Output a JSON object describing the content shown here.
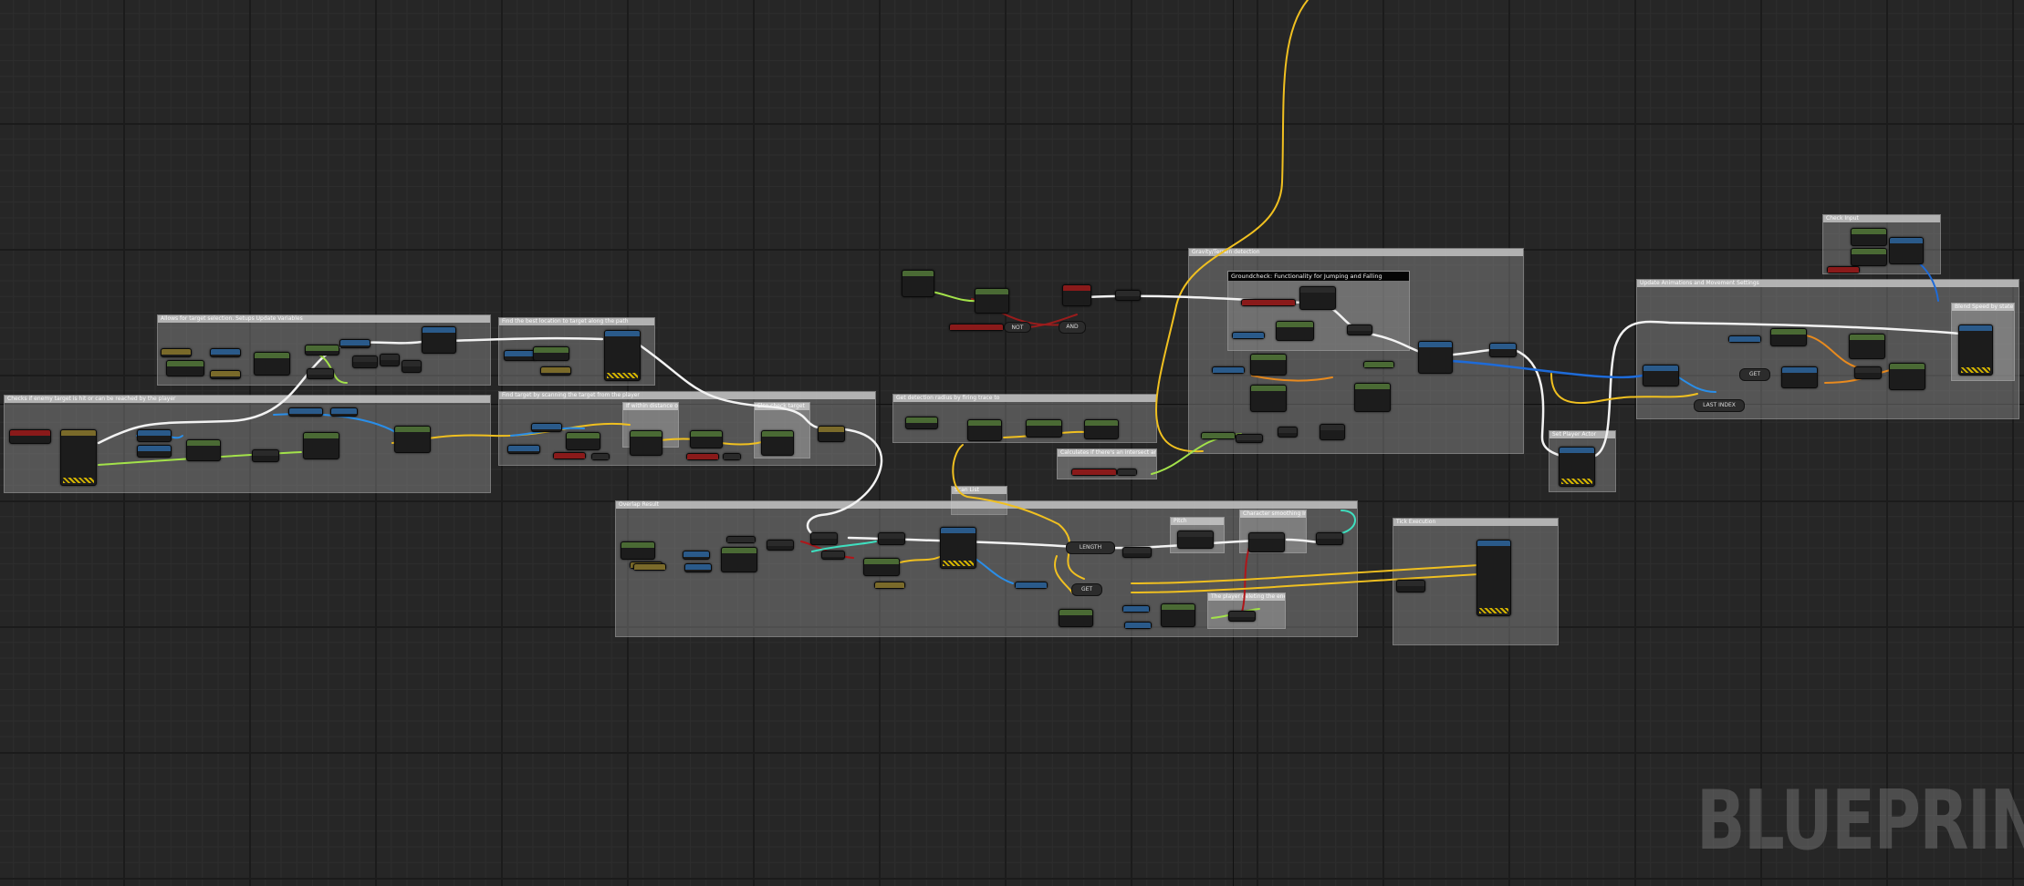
{
  "app": {
    "watermark": "BLUEPRINT"
  },
  "colors": {
    "exec_wire": "#f2f2f2",
    "bool_wire": "#9a1c1c",
    "float_wire": "#a3e24a",
    "vector_wire": "#f0c020",
    "object_wire": "#2a8ee8",
    "struct_wire": "#1e6bd8",
    "byte_wire": "#e88a1e",
    "int_wire": "#3ee0c0",
    "comment_fill": "rgba(150,150,150,0.42)"
  },
  "comments": {
    "target_check": "Allows for target selection. Setups Update Variables",
    "frame_lock": "Find the best location to target along the path",
    "main_attack": "Checks if enemy target is hit or can be reached by the player",
    "approach": "Find target by scanning the target from the player",
    "approach_sub1": "If within distance of player",
    "approach_sub2": "Else check target",
    "detection": "Get detection radius by firing trace to",
    "dist_note": "Calculates if there's an intersect and gets the new Distance",
    "scan_note": "Scan List",
    "gravity_block": "Gravity/Terrain detection",
    "groundcheck": "Groundcheck: Functionality for Jumping and Falling",
    "anim_block": "Update Animations and Movement Settings",
    "anim_note": "Blend Speed by state",
    "input_note": "Check Input",
    "small_block": "Set Player Actor",
    "overlap_block": "Overlap Result",
    "pitch_note": "Pitch",
    "smooth_note": "Character smoothing Interpolation",
    "scoring_note": "The player deleting the enemy",
    "bottom_right": "Tick Execution"
  },
  "labels": {
    "get": "GET",
    "last_index": "LAST INDEX",
    "length": "LENGTH",
    "and": "AND",
    "not": "NOT"
  }
}
